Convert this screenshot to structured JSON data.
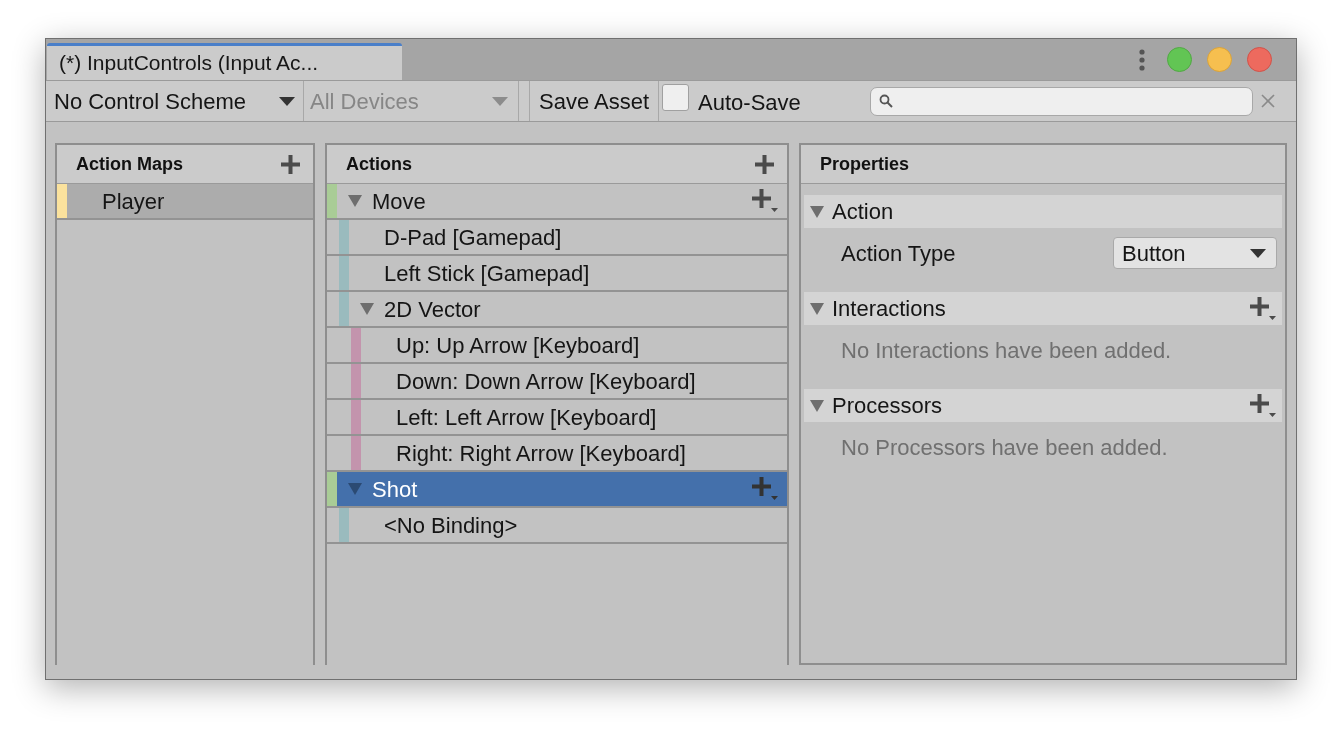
{
  "window": {
    "tab_title": "(*) InputControls (Input Ac..."
  },
  "toolbar": {
    "control_scheme": {
      "value": "No Control Scheme"
    },
    "device": {
      "value": "All Devices",
      "disabled": true
    },
    "save_button": {
      "label": "Save Asset"
    },
    "auto_save": {
      "label": "Auto-Save",
      "checked": false
    }
  },
  "action_maps": {
    "title": "Action Maps",
    "items": [
      {
        "label": "Player",
        "selected": true
      }
    ]
  },
  "actions": {
    "title": "Actions",
    "items": [
      {
        "kind": "action",
        "label": "Move",
        "expanded": true,
        "selected": false,
        "children": [
          {
            "kind": "binding",
            "label": "D-Pad [Gamepad]",
            "selected": false
          },
          {
            "kind": "binding",
            "label": "Left Stick [Gamepad]",
            "selected": false
          },
          {
            "kind": "composite",
            "label": "2D Vector",
            "expanded": true,
            "selected": false,
            "children": [
              {
                "kind": "part",
                "label": "Up: Up Arrow [Keyboard]",
                "selected": false
              },
              {
                "kind": "part",
                "label": "Down: Down Arrow [Keyboard]",
                "selected": false
              },
              {
                "kind": "part",
                "label": "Left: Left Arrow [Keyboard]",
                "selected": false
              },
              {
                "kind": "part",
                "label": "Right: Right Arrow [Keyboard]",
                "selected": false
              }
            ]
          }
        ]
      },
      {
        "kind": "action",
        "label": "Shot",
        "expanded": true,
        "selected": true,
        "children": [
          {
            "kind": "binding",
            "label": "<No Binding>",
            "selected": false
          }
        ]
      }
    ]
  },
  "properties": {
    "title": "Properties",
    "sections": [
      {
        "kind": "fields",
        "title": "Action",
        "expanded": true,
        "fields": [
          {
            "label": "Action Type",
            "value": "Button"
          }
        ]
      },
      {
        "kind": "list",
        "title": "Interactions",
        "expanded": true,
        "empty_text": "No Interactions have been added."
      },
      {
        "kind": "list",
        "title": "Processors",
        "expanded": true,
        "empty_text": "No Processors have been added."
      }
    ]
  }
}
